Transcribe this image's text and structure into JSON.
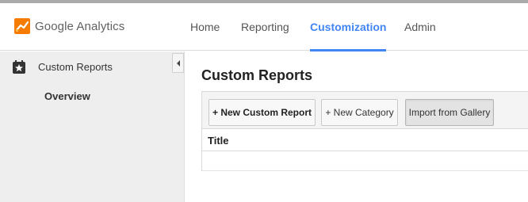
{
  "app": {
    "name": "Google Analytics",
    "logo_icon": "analytics-logo-icon",
    "brand_color": "#f57c00"
  },
  "nav": {
    "items": [
      {
        "label": "Home",
        "active": false
      },
      {
        "label": "Reporting",
        "active": false
      },
      {
        "label": "Customization",
        "active": true
      },
      {
        "label": "Admin",
        "active": false
      }
    ],
    "active_color": "#4285f4"
  },
  "sidebar": {
    "section": {
      "label": "Custom Reports",
      "icon": "custom-reports-icon"
    },
    "sub_items": [
      {
        "label": "Overview",
        "selected": true
      }
    ],
    "collapse_icon": "collapse-left-icon"
  },
  "main": {
    "title": "Custom Reports",
    "toolbar": {
      "new_report_label": "+ New Custom Report",
      "new_category_label": "+ New Category",
      "import_gallery_label": "Import from Gallery"
    },
    "table": {
      "columns": [
        "Title"
      ],
      "rows": []
    }
  }
}
